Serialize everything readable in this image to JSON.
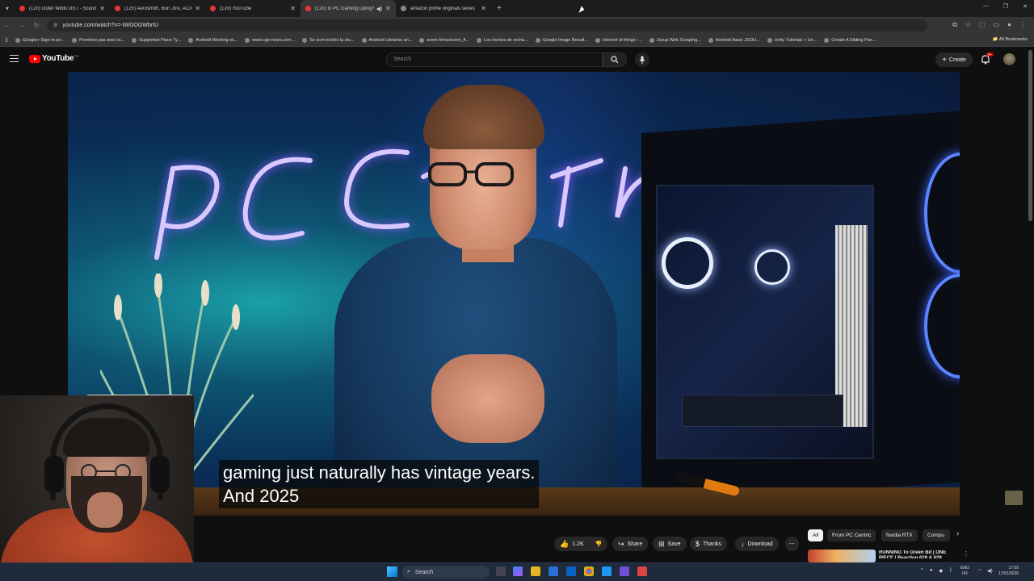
{
  "browser": {
    "tabs": [
      {
        "title": "(120) Outer Wilds OST - Soundt",
        "active": false
      },
      {
        "title": "(120) Aerosmith, Bon Jovi, AC/D",
        "active": false
      },
      {
        "title": "(120) YouTube",
        "active": false
      },
      {
        "title": "(120) Is PC Gaming Dying? (",
        "active": true
      },
      {
        "title": "amazon prime originals series",
        "active": false
      }
    ],
    "url": "youtube.com/watch?v=-tWGOGWbrIU",
    "bookmarks": [
      "Google+ Sign-In po...",
      "Premiers pas avec la...",
      "Supported Place Ty...",
      "Android Working wi...",
      "www.cge-news.com...",
      "Se sont nichés la stu...",
      "Android Libraries an...",
      "avem.fr/rss/avem_fl...",
      "Les bornes de recha...",
      "Google Image Result...",
      "internet of things -...",
      "Jsoup Web Scraping...",
      "Android Basic JSOU...",
      "Unity Tutorials + Un...",
      "Create A Sliding Pan..."
    ],
    "all_bookmarks_label": "All Bookmarks"
  },
  "youtube": {
    "logo_text": "YouTube",
    "logo_country": "FR",
    "search_placeholder": "Search",
    "create_label": "Create",
    "notification_count": "9+",
    "subtitle_line1": "gaming just naturally has vintage years.",
    "subtitle_line2": "And 2025",
    "like_count": "1.2K",
    "actions": {
      "share": "Share",
      "save": "Save",
      "thanks": "Thanks",
      "download": "Download"
    },
    "chips": [
      "All",
      "From PC Centric",
      "Nvidia RTX",
      "Compu"
    ],
    "recommendation_title": "RUNNING To Green Bit | ONE PIECE | Reaction 628 & 629"
  },
  "taskbar": {
    "search_label": "Search",
    "lang_line1": "ENG",
    "lang_line2": "FR",
    "time": "17:09",
    "date": "17/01/2026"
  },
  "colors": {
    "youtube_red": "#ff0000",
    "background": "#0f0f0f",
    "chip_selected": "#f1f1f1"
  }
}
